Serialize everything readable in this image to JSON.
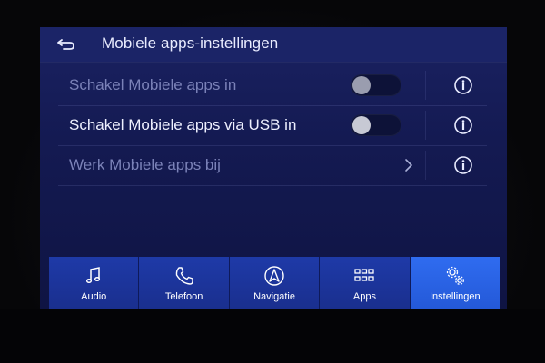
{
  "header": {
    "title": "Mobiele apps-instellingen",
    "back_icon": "back-arrow-icon"
  },
  "settings": [
    {
      "label": "Schakel Mobiele apps in",
      "control": "toggle",
      "state": "off",
      "enabled": false
    },
    {
      "label": "Schakel Mobiele apps via USB in",
      "control": "toggle",
      "state": "off",
      "enabled": true
    },
    {
      "label": "Werk Mobiele apps bij",
      "control": "chevron",
      "enabled": false
    }
  ],
  "nav": {
    "items": [
      {
        "label": "Audio",
        "icon": "music-note-icon"
      },
      {
        "label": "Telefoon",
        "icon": "phone-icon"
      },
      {
        "label": "Navigatie",
        "icon": "navigation-icon"
      },
      {
        "label": "Apps",
        "icon": "apps-grid-icon"
      },
      {
        "label": "Instellingen",
        "icon": "settings-gears-icon",
        "active": true
      }
    ]
  },
  "colors": {
    "header": "#1b2467",
    "active_tab": "#2f6cf0",
    "tab": "#1e3aa8"
  }
}
